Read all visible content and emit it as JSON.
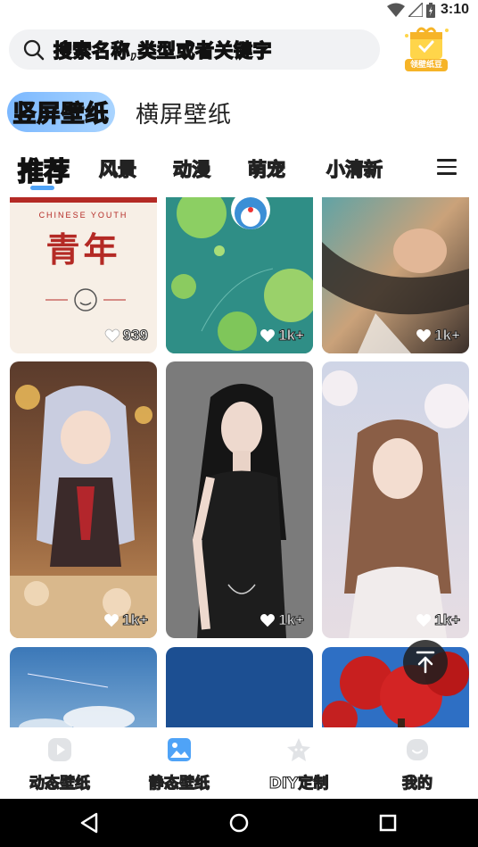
{
  "status_bar": {
    "time": "3:10"
  },
  "search": {
    "placeholder": "搜索名称,类型或者关键字"
  },
  "badge": {
    "label": "领壁纸豆"
  },
  "orientation_tabs": [
    "竖屏壁纸",
    "横屏壁纸"
  ],
  "category_tabs": [
    "推荐",
    "风景",
    "动漫",
    "萌宠",
    "小清新"
  ],
  "cards": {
    "top_text_top": "CHINESE YOUTH",
    "top_text_main": "青年",
    "likes": [
      "939",
      "1k+",
      "1k+",
      "1k+",
      "1k+",
      "1k+"
    ]
  },
  "bottom_nav": [
    "动态壁纸",
    "静态壁纸",
    "DIY定制",
    "我的"
  ],
  "colors": {
    "accent": "#4fa3f7",
    "badge": "#f6b428"
  }
}
